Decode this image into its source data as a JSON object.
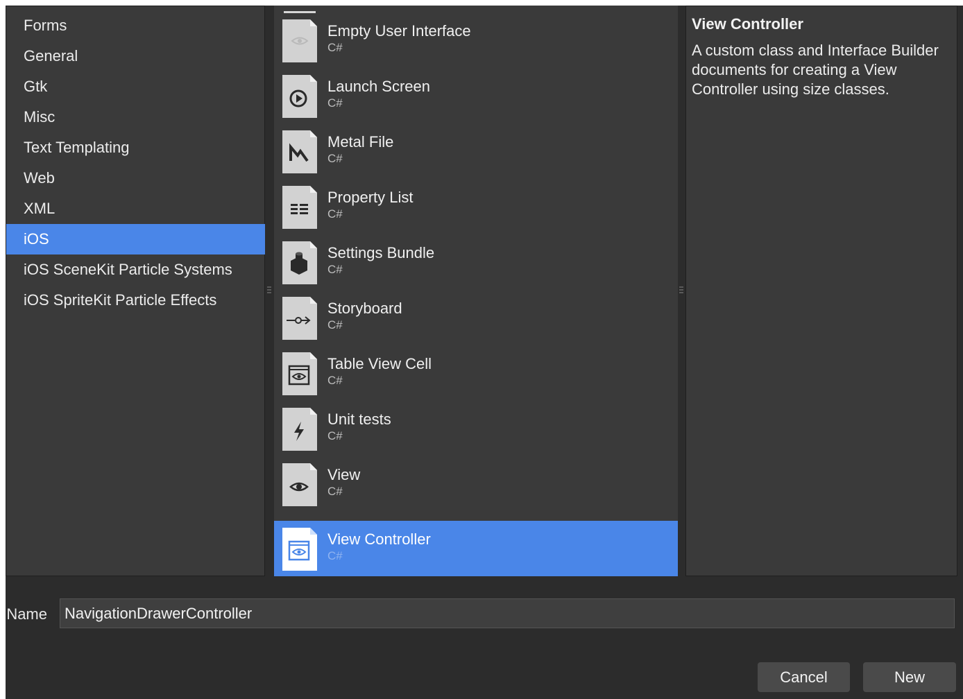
{
  "categories": [
    {
      "label": "Forms",
      "selected": false
    },
    {
      "label": "General",
      "selected": false
    },
    {
      "label": "Gtk",
      "selected": false
    },
    {
      "label": "Misc",
      "selected": false
    },
    {
      "label": "Text Templating",
      "selected": false
    },
    {
      "label": "Web",
      "selected": false
    },
    {
      "label": "XML",
      "selected": false
    },
    {
      "label": "iOS",
      "selected": true
    },
    {
      "label": "iOS SceneKit Particle Systems",
      "selected": false
    },
    {
      "label": "iOS SpriteKit Particle Effects",
      "selected": false
    }
  ],
  "templates": [
    {
      "name": "Empty User Interface",
      "lang": "C#",
      "icon": "eye-icon-faded",
      "selected": false
    },
    {
      "name": "Launch Screen",
      "lang": "C#",
      "icon": "play-circle-icon",
      "selected": false
    },
    {
      "name": "Metal File",
      "lang": "C#",
      "icon": "metal-icon",
      "selected": false
    },
    {
      "name": "Property List",
      "lang": "C#",
      "icon": "list-icon",
      "selected": false
    },
    {
      "name": "Settings Bundle",
      "lang": "C#",
      "icon": "lego-brick-icon",
      "selected": false
    },
    {
      "name": "Storyboard",
      "lang": "C#",
      "icon": "segue-arrow-icon",
      "selected": false
    },
    {
      "name": "Table View Cell",
      "lang": "C#",
      "icon": "window-eye-icon",
      "selected": false
    },
    {
      "name": "Unit tests",
      "lang": "C#",
      "icon": "lightning-icon",
      "selected": false
    },
    {
      "name": "View",
      "lang": "C#",
      "icon": "eye-icon",
      "selected": false
    },
    {
      "name": "View Controller",
      "lang": "C#",
      "icon": "window-eye-icon",
      "selected": true
    }
  ],
  "description": {
    "title": "View Controller",
    "text": "A custom class and Interface Builder documents for creating a View Controller using size classes."
  },
  "name_field": {
    "label": "Name:",
    "value": "NavigationDrawerController"
  },
  "buttons": {
    "cancel": "Cancel",
    "new": "New"
  },
  "colors": {
    "selection": "#4a86e8",
    "pane": "#3a3a3a",
    "background": "#2c2c2c"
  }
}
